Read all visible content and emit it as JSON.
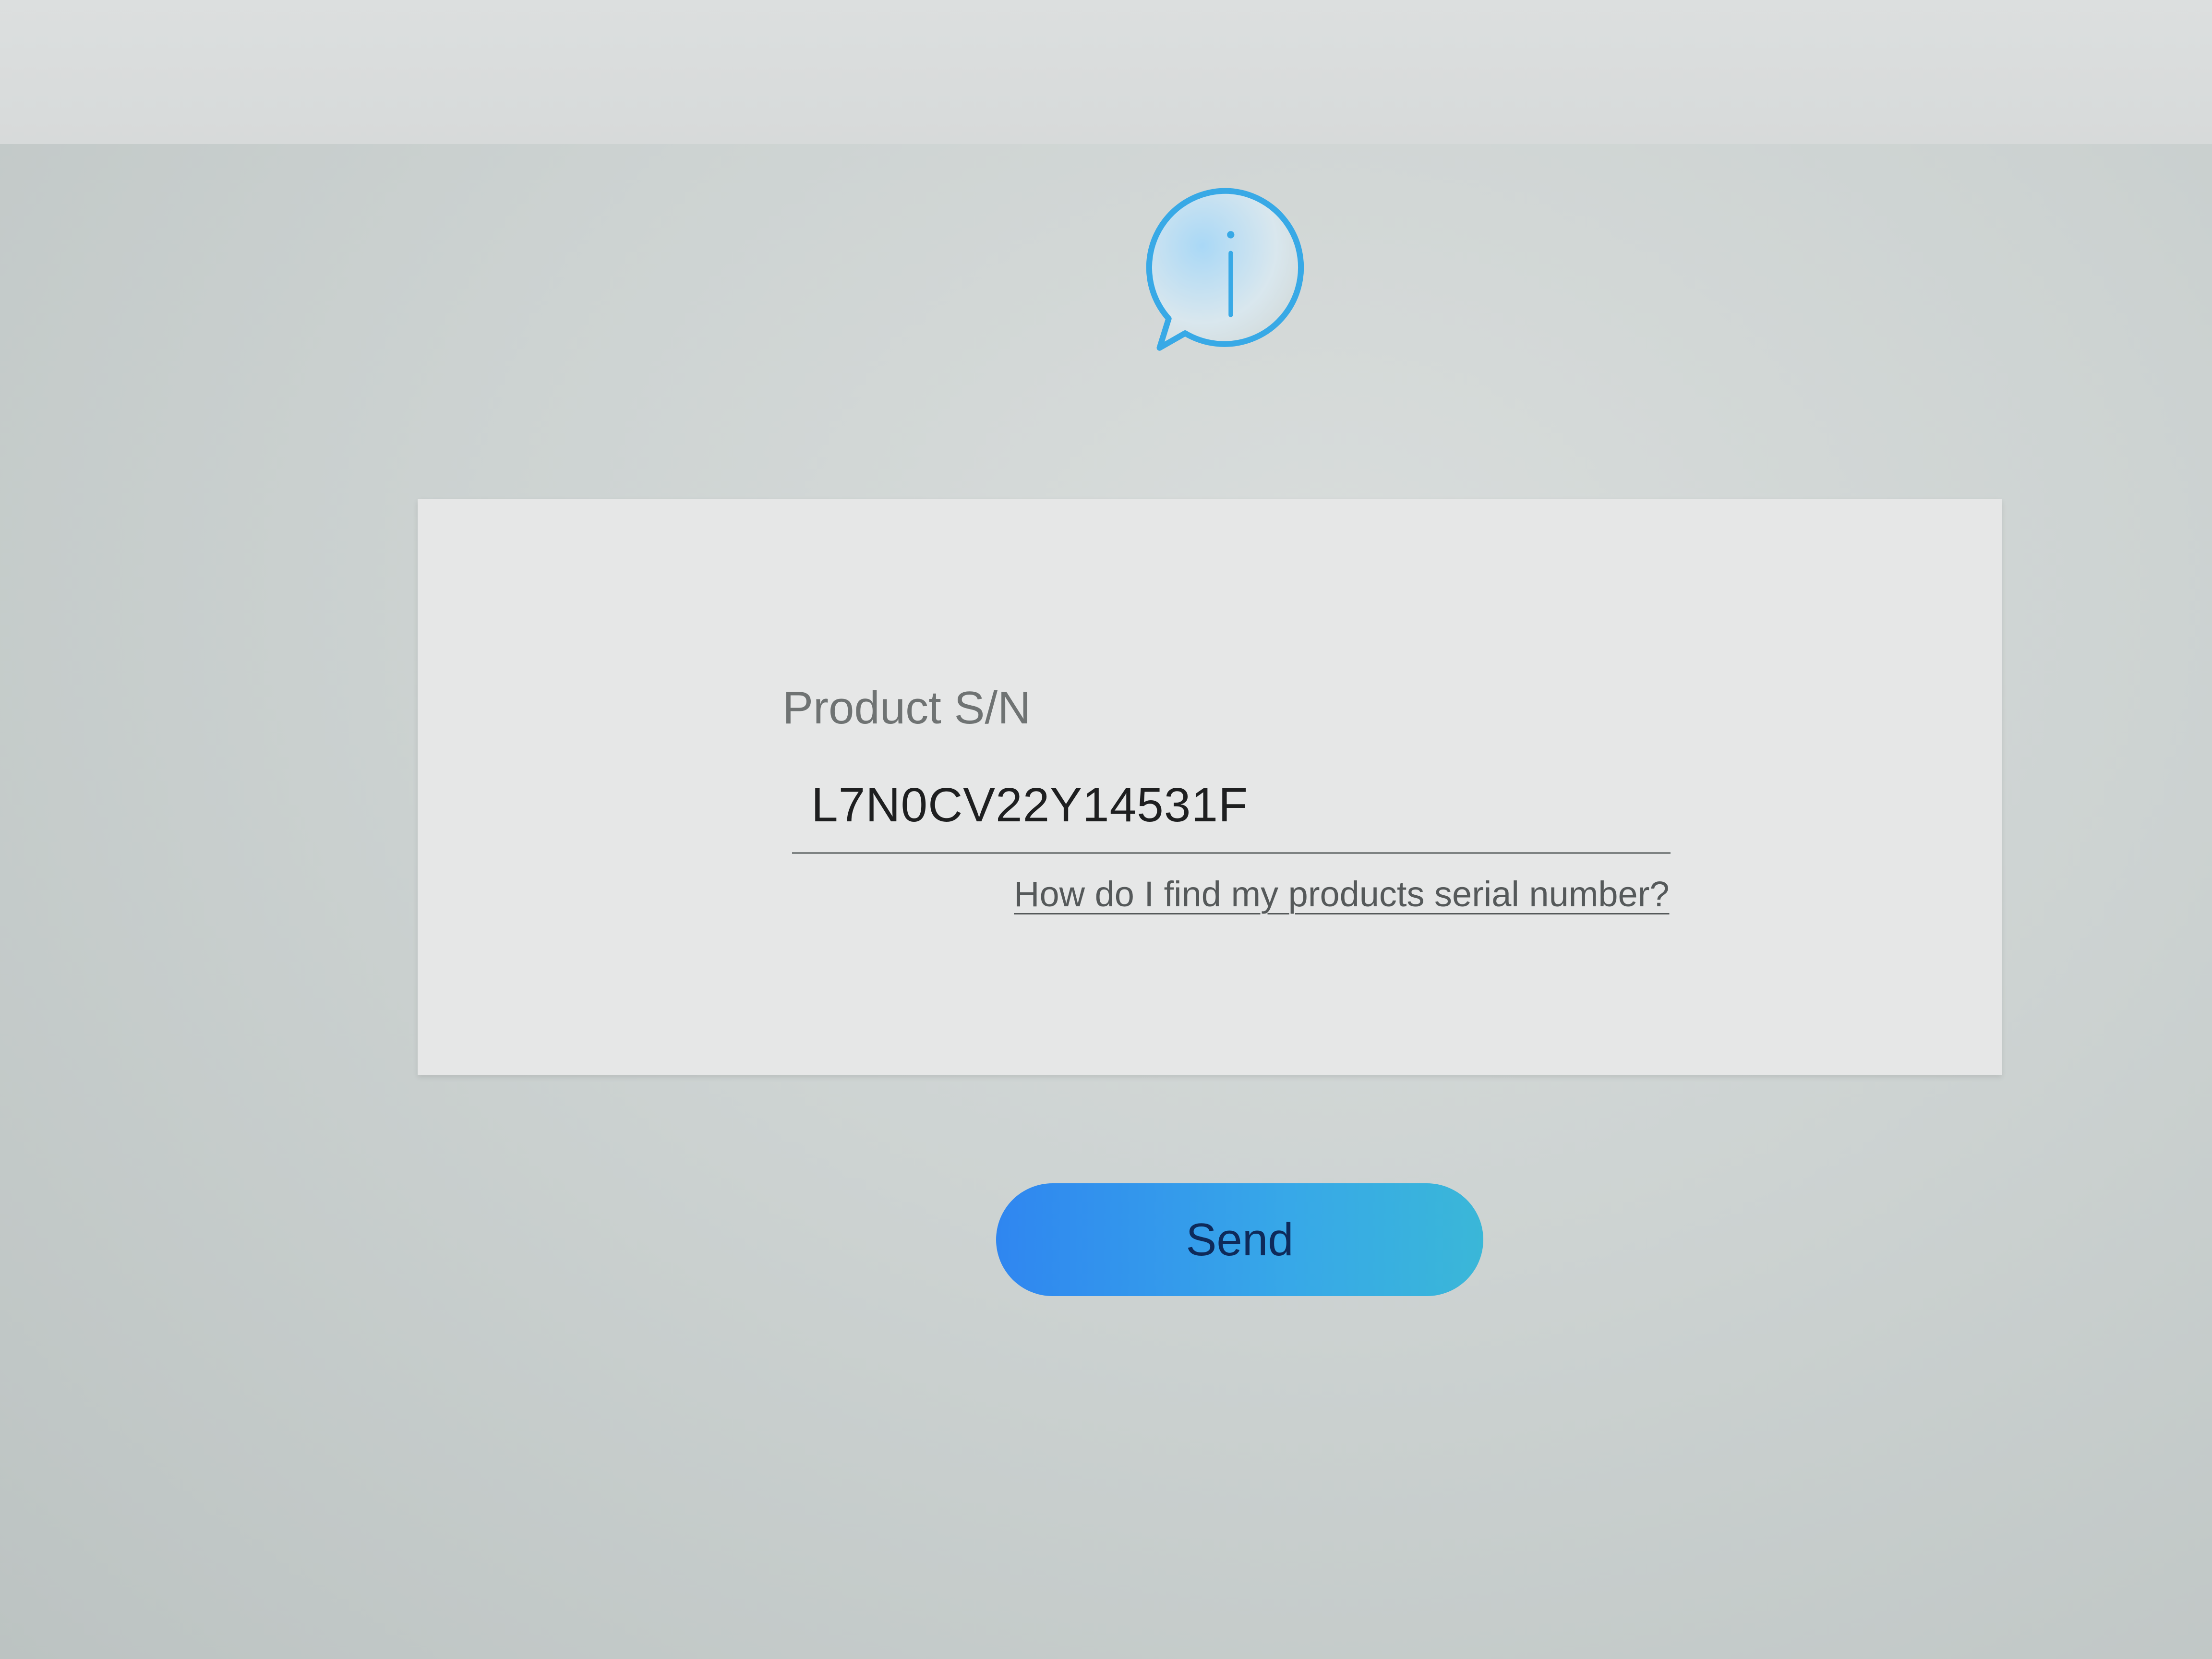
{
  "form": {
    "label": "Product S/N",
    "serial_value": "L7N0CV22Y14531F",
    "help_link": "How do I find my products serial number?"
  },
  "actions": {
    "send_label": "Send"
  },
  "icons": {
    "info": "info-speech-bubble-icon"
  },
  "colors": {
    "accent_start": "#2f86f0",
    "accent_end": "#3ab7d8",
    "icon_stroke": "#38a9e6"
  }
}
